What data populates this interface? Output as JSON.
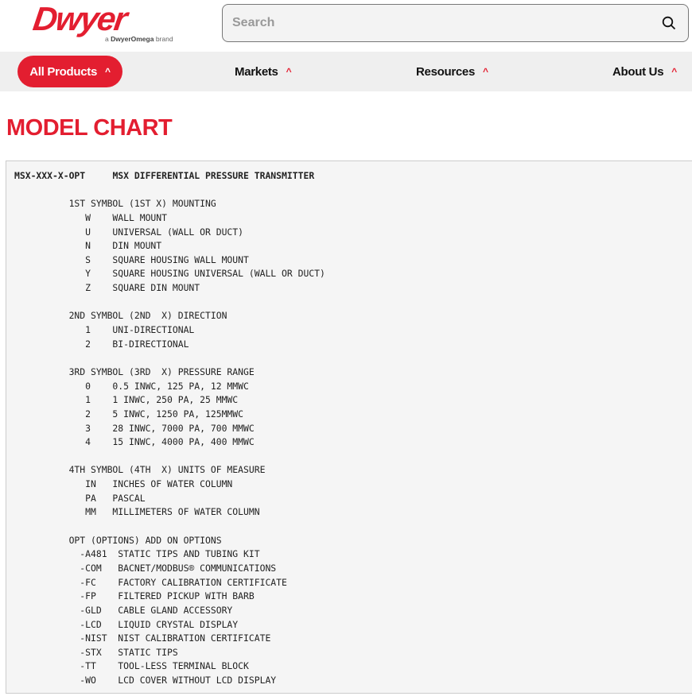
{
  "header": {
    "logo_text": "Dwyer",
    "logo_sub_brand": "DwyerOmega",
    "logo_sub_prefix": "a",
    "logo_sub_suffix": "brand",
    "search_placeholder": "Search"
  },
  "nav": {
    "all_products": "All Products",
    "items": [
      "Markets",
      "Resources",
      "About Us"
    ]
  },
  "page_title": "MODEL CHART",
  "chart": {
    "model": "MSX-XXX-X-OPT",
    "title": "MSX DIFFERENTIAL PRESSURE TRANSMITTER",
    "sections": [
      {
        "heading": "1ST SYMBOL (1ST X) MOUNTING",
        "items": [
          [
            "W",
            "WALL MOUNT"
          ],
          [
            "U",
            "UNIVERSAL (WALL OR DUCT)"
          ],
          [
            "N",
            "DIN MOUNT"
          ],
          [
            "S",
            "SQUARE HOUSING WALL MOUNT"
          ],
          [
            "Y",
            "SQUARE HOUSING UNIVERSAL (WALL OR DUCT)"
          ],
          [
            "Z",
            "SQUARE DIN MOUNT"
          ]
        ]
      },
      {
        "heading": "2ND SYMBOL (2ND  X) DIRECTION",
        "items": [
          [
            "1",
            "UNI-DIRECTIONAL"
          ],
          [
            "2",
            "BI-DIRECTIONAL"
          ]
        ]
      },
      {
        "heading": "3RD SYMBOL (3RD  X) PRESSURE RANGE",
        "items": [
          [
            "0",
            "0.5 INWC, 125 PA, 12 MMWC"
          ],
          [
            "1",
            "1 INWC, 250 PA, 25 MMWC"
          ],
          [
            "2",
            "5 INWC, 1250 PA, 125MMWC"
          ],
          [
            "3",
            "28 INWC, 7000 PA, 700 MMWC"
          ],
          [
            "4",
            "15 INWC, 4000 PA, 400 MMWC"
          ]
        ]
      },
      {
        "heading": "4TH SYMBOL (4TH  X) UNITS OF MEASURE",
        "items": [
          [
            "IN",
            "INCHES OF WATER COLUMN"
          ],
          [
            "PA",
            "PASCAL"
          ],
          [
            "MM",
            "MILLIMETERS OF WATER COLUMN"
          ]
        ]
      },
      {
        "heading": "OPT (OPTIONS) ADD ON OPTIONS",
        "options": true,
        "items": [
          [
            "-A481",
            "STATIC TIPS AND TUBING KIT"
          ],
          [
            "-COM",
            "BACNET/MODBUS® COMMUNICATIONS"
          ],
          [
            "-FC",
            "FACTORY CALIBRATION CERTIFICATE"
          ],
          [
            "-FP",
            "FILTERED PICKUP WITH BARB"
          ],
          [
            "-GLD",
            "CABLE GLAND ACCESSORY"
          ],
          [
            "-LCD",
            "LIQUID CRYSTAL DISPLAY"
          ],
          [
            "-NIST",
            "NIST CALIBRATION CERTIFICATE"
          ],
          [
            "-STX",
            "STATIC TIPS"
          ],
          [
            "-TT",
            "TOOL-LESS TERMINAL BLOCK"
          ],
          [
            "-WO",
            "LCD COVER WITHOUT LCD DISPLAY"
          ]
        ]
      }
    ]
  },
  "colors": {
    "brand": "#e31e30"
  }
}
